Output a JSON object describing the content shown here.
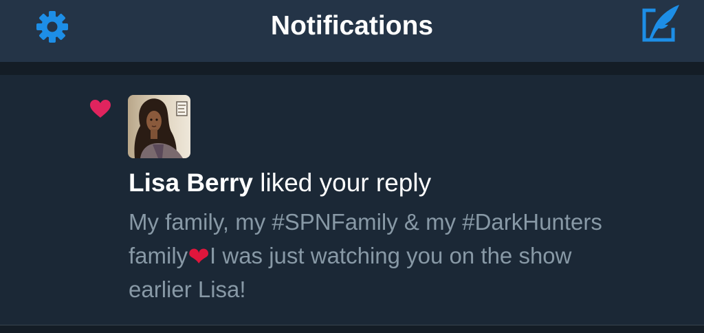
{
  "header": {
    "title": "Notifications",
    "settings_icon": "gear-icon",
    "compose_icon": "compose-quill-icon"
  },
  "notification": {
    "type_icon": "heart-icon",
    "user_name": "Lisa Berry",
    "action_text": " liked your reply",
    "tweet_lines": [
      "My family, my #SPNFamily & my #DarkHunters",
      "family",
      "I was just watching you on the show",
      "earlier Lisa!"
    ],
    "emoji": "❤"
  },
  "colors": {
    "header_bg": "#243447",
    "body_bg": "#1b2836",
    "accent": "#1da1f2",
    "like": "#e0245e",
    "muted_text": "#8899a6"
  }
}
